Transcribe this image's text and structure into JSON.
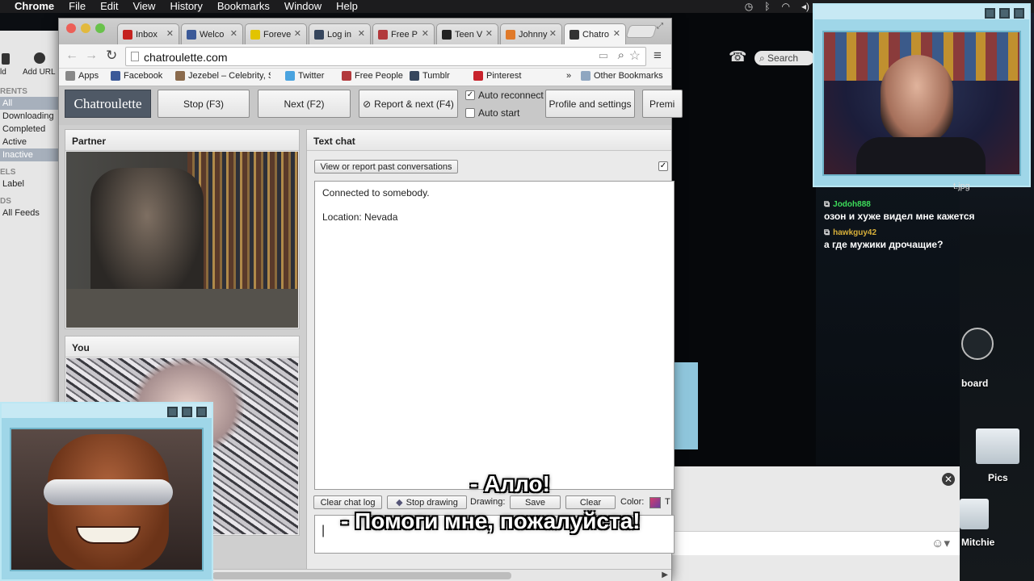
{
  "menubar": {
    "app": "Chrome",
    "items": [
      "File",
      "Edit",
      "View",
      "History",
      "Bookmarks",
      "Window",
      "Help"
    ]
  },
  "bg_window": {
    "left_glyphs": [
      "ld",
      "Add URL"
    ],
    "sections": [
      {
        "header": "RENTS",
        "items": [
          "All",
          "Downloading",
          "Completed",
          "Active",
          "Inactive"
        ]
      },
      {
        "header": "ELS",
        "items": [
          "Label"
        ]
      },
      {
        "header": "DS",
        "items": [
          "All Feeds"
        ]
      }
    ],
    "selected_items": [
      "All",
      "Inactive"
    ]
  },
  "browser": {
    "tabs": [
      {
        "label": "Inbox",
        "icon": "gmail-icon",
        "color": "#c5221f"
      },
      {
        "label": "Welco",
        "icon": "facebook-icon",
        "color": "#3b5998"
      },
      {
        "label": "Foreve",
        "icon": "forever21-icon",
        "color": "#e2c400"
      },
      {
        "label": "Log in",
        "icon": "tumblr-icon",
        "color": "#36465d"
      },
      {
        "label": "Free P",
        "icon": "freepeople-icon",
        "color": "#b2393c"
      },
      {
        "label": "Teen V",
        "icon": "teenvogue-icon",
        "color": "#222222"
      },
      {
        "label": "Johnny",
        "icon": "johnny-icon",
        "color": "#e07a2a"
      },
      {
        "label": "Chatro",
        "icon": "chatroulette-icon",
        "color": "#333333",
        "active": true
      }
    ],
    "url": "chatroulette.com",
    "bookmarks": [
      {
        "label": "Apps",
        "icon": "apps-icon",
        "color": "#888888"
      },
      {
        "label": "Facebook",
        "icon": "facebook-icon",
        "color": "#3b5998"
      },
      {
        "label": "Jezebel – Celebrity, S",
        "icon": "jezebel-icon",
        "color": "#8a6a4c"
      },
      {
        "label": "Twitter",
        "icon": "twitter-icon",
        "color": "#4aa3df"
      },
      {
        "label": "Free People",
        "icon": "freepeople-icon",
        "color": "#b2393c"
      },
      {
        "label": "Tumblr",
        "icon": "tumblr-icon",
        "color": "#36465d"
      },
      {
        "label": "Pinterest",
        "icon": "pinterest-icon",
        "color": "#c8232c"
      }
    ],
    "bookmarks_more": "»",
    "other_bookmarks": "Other Bookmarks"
  },
  "chatroulette": {
    "logo": "Chatroulette",
    "buttons": {
      "stop": "Stop (F3)",
      "next": "Next (F2)",
      "report_next": "Report & next (F4)",
      "profile": "Profile and settings",
      "premium": "Premi"
    },
    "auto_reconnect": {
      "label": "Auto reconnect",
      "checked": true
    },
    "auto_start": {
      "label": "Auto start",
      "checked": false
    },
    "partner_title": "Partner",
    "you_title": "You",
    "text_chat_title": "Text chat",
    "view_report": "View or report past conversations",
    "messages": [
      "Connected to somebody.",
      "Location: Nevada"
    ],
    "clear_log": "Clear chat log",
    "stop_drawing": "Stop drawing",
    "drawing_label": "Drawing:",
    "save": "Save",
    "clear": "Clear",
    "color_label": "Color:",
    "color_trailing": "T",
    "accent_color": "#4f5966"
  },
  "stream_chat": [
    {
      "user": "Jodoh888",
      "user_color": "#3ddc5a",
      "text": "озон и хуже видел мне кажется"
    },
    {
      "user": "hawkguy42",
      "user_color": "#d8b03a",
      "text": "а где мужики дрочащие?"
    }
  ],
  "stream_partial": "t.jpg",
  "desktop": {
    "folders": [
      "Pics",
      "Mitchie"
    ],
    "dashboard_label": "board"
  },
  "subtitles": [
    "- Алло!",
    "- Помоги мне, пожалуйста!"
  ],
  "overlay_color": "#9fd6e8"
}
